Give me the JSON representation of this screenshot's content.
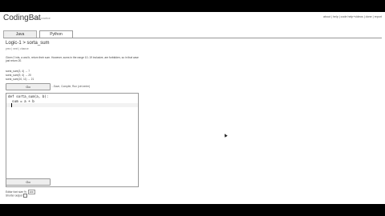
{
  "header": {
    "logo": "CodingBat",
    "tagline": "code practice",
    "links": [
      "about",
      "help",
      "code help+videos",
      "done",
      "report"
    ]
  },
  "tabs": [
    "Java",
    "Python"
  ],
  "problem": {
    "title": "Logic-1 > sorta_sum",
    "prev": "prev",
    "next": "next",
    "chance": "chance",
    "description": "Given 2 ints, a and b, return their sum. However, sums in the range 10..19 inclusive, are forbidden, so in that case just return 20.",
    "examples": [
      "sorta_sum(3, 4) → 7",
      "sorta_sum(9, 4) → 20",
      "sorta_sum(10, 11) → 21"
    ]
  },
  "buttons": {
    "go_top": "Go",
    "go_bottom": "Go",
    "hint": "...Save, Compile, Run (ctrl-enter)"
  },
  "editor": {
    "line1": "def sorta_sum(a, b):",
    "line2": "  sum = a + b"
  },
  "options": {
    "font_label": "Editor font size %:",
    "font_value": "100",
    "shorter_label": "Shorter output"
  }
}
